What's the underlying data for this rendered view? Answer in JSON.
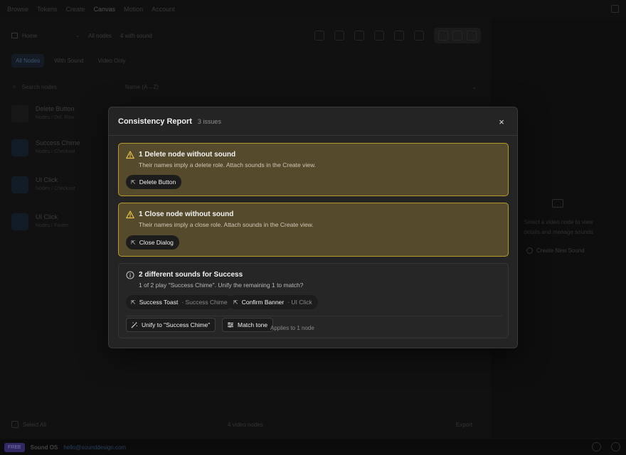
{
  "topnav": {
    "items": [
      "Browse",
      "Tokens",
      "Create",
      "Canvas",
      "Motion",
      "Account"
    ],
    "active_index": 3
  },
  "toolbar": {
    "view_label": "Home",
    "stat_1": "All nodes",
    "stat_2": "4 with sound"
  },
  "filters": {
    "tabs": [
      "All Nodes",
      "With Sound",
      "Video Only"
    ],
    "active_index": 0
  },
  "search": {
    "placeholder": "Search nodes",
    "sort_label": "Name (A→Z)"
  },
  "nodes": [
    {
      "name": "Delete Button",
      "path": "Nodes / Del. Row"
    },
    {
      "name": "Success Chime",
      "path": "Nodes / Checkout"
    },
    {
      "name": "UI Click",
      "path": "Nodes / Checkout"
    },
    {
      "name": "UI Click",
      "path": "Nodes / Footer"
    }
  ],
  "bottom": {
    "select_all": "Select All",
    "count": "4 video nodes",
    "export": "Export"
  },
  "side_panel": {
    "hint": "Select a video node to view details and manage sounds",
    "create_label": "Create New Sound"
  },
  "status": {
    "badge": "FREE",
    "app_name": "Sound OS",
    "email": "hello@sounddesign.com"
  },
  "modal": {
    "title": "Consistency Report",
    "count": "3 issues",
    "close_label": "×",
    "issues": [
      {
        "title": "1 Delete node without sound",
        "description": "Their names imply a delete role. Attach sounds in the Create view.",
        "chips": [
          {
            "label": "Delete Button"
          }
        ]
      },
      {
        "title": "1 Close node without sound",
        "description": "Their names imply a close role. Attach sounds in the Create view.",
        "chips": [
          {
            "label": "Close Dialog"
          }
        ]
      },
      {
        "title": "2 different sounds for Success",
        "description": "1 of 2 play \"Success Chime\". Unify the remaining 1 to match?",
        "chips": [
          {
            "label": "Success Toast",
            "sound": "· Success Chime"
          },
          {
            "label": "Confirm Banner",
            "sound": "· UI Click"
          }
        ],
        "unify_label": "Unify to \"Success Chime\"",
        "match_label": "Match tone",
        "applies_label": "Applies to 1 node"
      }
    ]
  },
  "colors": {
    "warning_bg": "#554a2c",
    "warning_border": "#b89a2a",
    "accent": "#4b3f9a"
  }
}
